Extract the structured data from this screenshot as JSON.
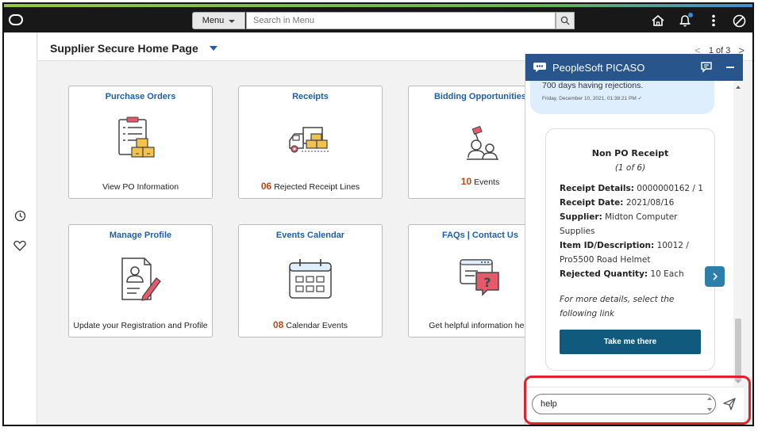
{
  "header": {
    "menu_label": "Menu",
    "search_placeholder": "Search in Menu",
    "icons": [
      "oracle-logo-icon",
      "search-icon",
      "home-icon",
      "notification-bell-icon",
      "more-options-icon",
      "navbar-compass-icon"
    ]
  },
  "left_rail": {
    "icons": [
      "recently-visited-icon",
      "favorites-heart-icon"
    ]
  },
  "page": {
    "title": "Supplier Secure Home Page",
    "pager": {
      "prev": "<",
      "text": "1 of 3",
      "next": ">"
    }
  },
  "tiles": [
    {
      "title": "Purchase Orders",
      "count": "",
      "label": "View PO Information",
      "icon": "purchase-orders-icon"
    },
    {
      "title": "Receipts",
      "count": "06",
      "label": "Rejected Receipt Lines",
      "icon": "receipts-truck-icon"
    },
    {
      "title": "Bidding Opportunities",
      "count": "10",
      "label": "Events",
      "icon": "bidding-auction-icon"
    },
    {
      "title": "Manage Profile",
      "count": "",
      "label": "Update your Registration and Profile",
      "icon": "profile-edit-icon"
    },
    {
      "title": "Events Calendar",
      "count": "08",
      "label": "Calendar Events",
      "icon": "calendar-icon"
    },
    {
      "title": "FAQs | Contact Us",
      "count": "",
      "label": "Get helpful information here",
      "icon": "faq-chat-icon"
    }
  ],
  "chat": {
    "title": "PeopleSoft PICASO",
    "user_message": "700 days having rejections.",
    "user_timestamp": "Friday, December 10, 2021, 01:38:21 PM ✓",
    "card": {
      "title": "Non PO Receipt",
      "subtitle": "(1 of 6)",
      "fields": [
        {
          "label": "Receipt Details:",
          "value": "0000000162 / 1"
        },
        {
          "label": "Receipt Date:",
          "value": "2021/08/16"
        },
        {
          "label": "Supplier:",
          "value": "Midton Computer Supplies"
        },
        {
          "label": "Item ID/Description:",
          "value": "10012 / Pro5500 Road Helmet"
        },
        {
          "label": "Rejected Quantity:",
          "value": "10 Each"
        }
      ],
      "note": "For more details, select the following link",
      "button_label": "Take me there"
    },
    "input_value": "help",
    "colors": {
      "header": "#27558c",
      "button": "#0f5a7d",
      "highlight": "#e0202a"
    }
  }
}
